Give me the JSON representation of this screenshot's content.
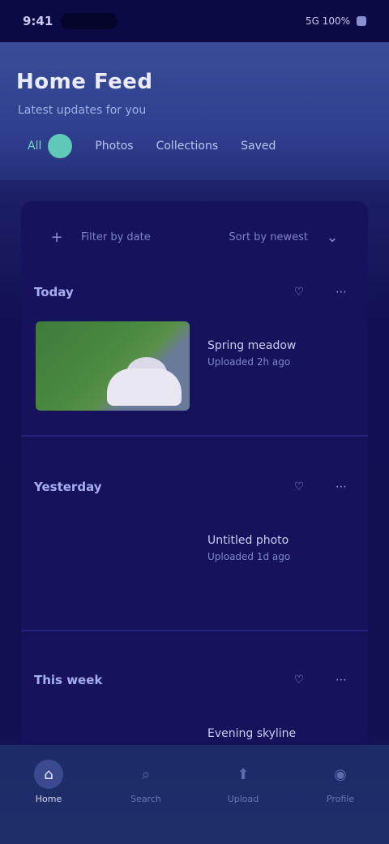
{
  "status_bar": {
    "time": "9:41",
    "right": "5G 100%"
  },
  "header": {
    "title": "Home Feed",
    "subtitle": "Latest updates for you",
    "tabs": [
      {
        "label": "All"
      },
      {
        "label": "Photos"
      },
      {
        "label": "Collections"
      },
      {
        "label": "Saved"
      }
    ]
  },
  "card": {
    "toolbar": {
      "left_label": "Filter by date",
      "right_label": "Sort by newest"
    },
    "sections": [
      {
        "title": "Today",
        "actions": [
          "♡",
          "⋯"
        ],
        "item_main": "Spring meadow",
        "item_sub": "Uploaded 2h ago"
      },
      {
        "title": "Yesterday",
        "actions": [
          "♡",
          "⋯"
        ],
        "item_main": "Untitled photo",
        "item_sub": "Uploaded 1d ago"
      },
      {
        "title": "This week",
        "actions": [
          "♡",
          "⋯"
        ],
        "item_main": "Evening skyline",
        "item_sub": ""
      }
    ]
  },
  "bottom_nav": {
    "items": [
      {
        "label": "Home",
        "icon": "home-icon",
        "glyph": "⌂"
      },
      {
        "label": "Search",
        "icon": "search-icon",
        "glyph": "⌕"
      },
      {
        "label": "Upload",
        "icon": "upload-icon",
        "glyph": "⬆"
      },
      {
        "label": "Profile",
        "icon": "profile-icon",
        "glyph": "◉"
      }
    ]
  },
  "colors": {
    "accent": "#5fc8b6",
    "header_bg": "#2e3e8c",
    "card_bg": "#16135c",
    "nav_bg": "#1d2c68"
  }
}
